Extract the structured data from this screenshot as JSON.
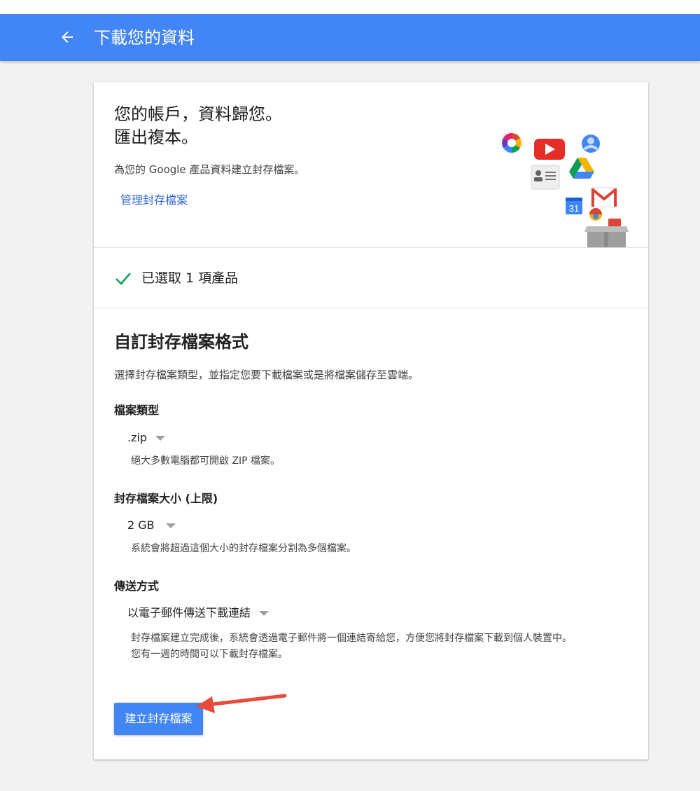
{
  "appbar": {
    "title": "下載您的資料",
    "back_icon": "arrow-back-icon"
  },
  "hero": {
    "heading_line1": "您的帳戶，資料歸您。",
    "heading_line2": "匯出複本。",
    "subtitle": "為您的 Google 產品資料建立封存檔案。",
    "manage_link": "管理封存檔案",
    "calendar_day": "31"
  },
  "selected": {
    "text": "已選取 1 項產品"
  },
  "format": {
    "title": "自訂封存檔案格式",
    "description": "選擇封存檔案類型，並指定您要下載檔案或是將檔案儲存至雲端。",
    "file_type": {
      "label": "檔案類型",
      "value": ".zip",
      "hint": "絕大多數電腦都可開啟 ZIP 檔案。"
    },
    "archive_size": {
      "label": "封存檔案大小 (上限)",
      "value": "2 GB",
      "hint": "系統會將超過這個大小的封存檔案分割為多個檔案。"
    },
    "delivery": {
      "label": "傳送方式",
      "value": "以電子郵件傳送下載連結",
      "hint_line1": "封存檔案建立完成後，系統會透過電子郵件將一個連結寄給您，方便您將封存檔案下載到個人裝置中。",
      "hint_line2": "您有一週的時間可以下載封存檔案。"
    }
  },
  "create_button": {
    "label": "建立封存檔案"
  },
  "colors": {
    "appbar": "#4285f4",
    "link": "#3367d6",
    "check": "#0f9d58",
    "button": "#4285f4",
    "annotation_arrow": "#e84b3c"
  }
}
